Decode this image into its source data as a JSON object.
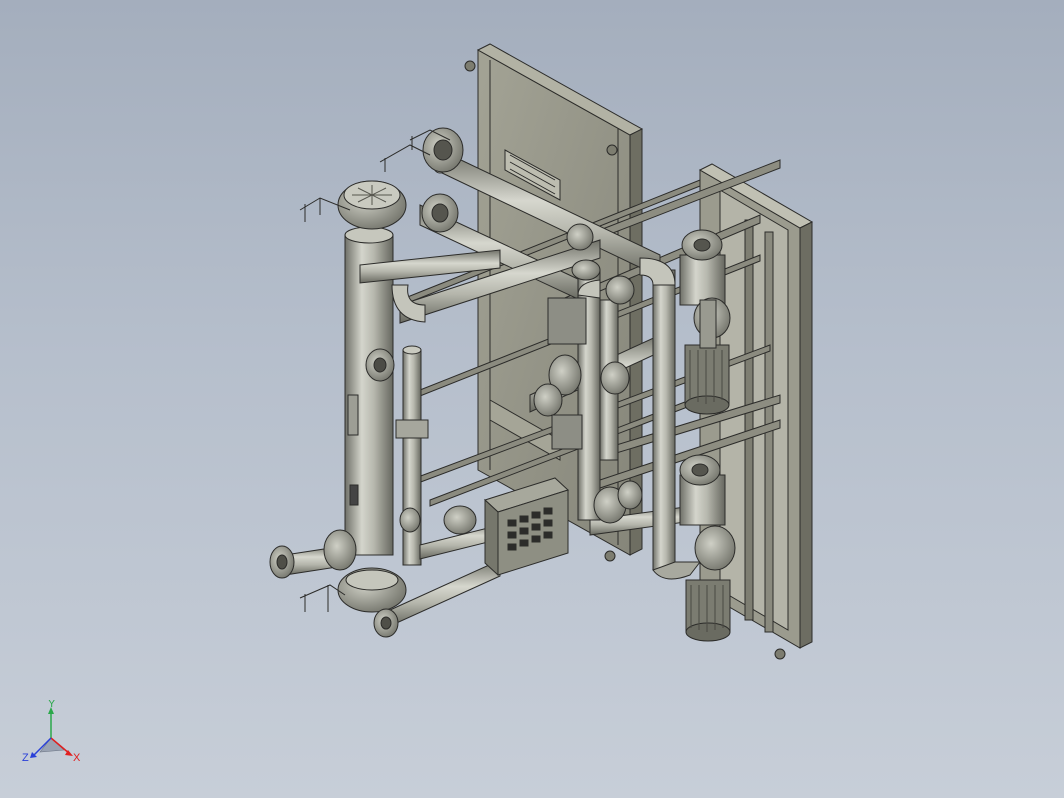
{
  "viewport": {
    "background_top": "#a4aebd",
    "background_bottom": "#c7ced8",
    "model_colors": {
      "frame": "#8f8f82",
      "frame_dark": "#6c6c60",
      "pipe": "#b9bab0",
      "pipe_dark": "#707068",
      "panel": "#9a9a8c",
      "motor": "#85857a",
      "outline": "#2c2c2a"
    }
  },
  "triad": {
    "x_label": "X",
    "y_label": "Y",
    "z_label": "Z",
    "x_color": "#e02020",
    "y_color": "#2aa84a",
    "z_color": "#2a40d8"
  }
}
